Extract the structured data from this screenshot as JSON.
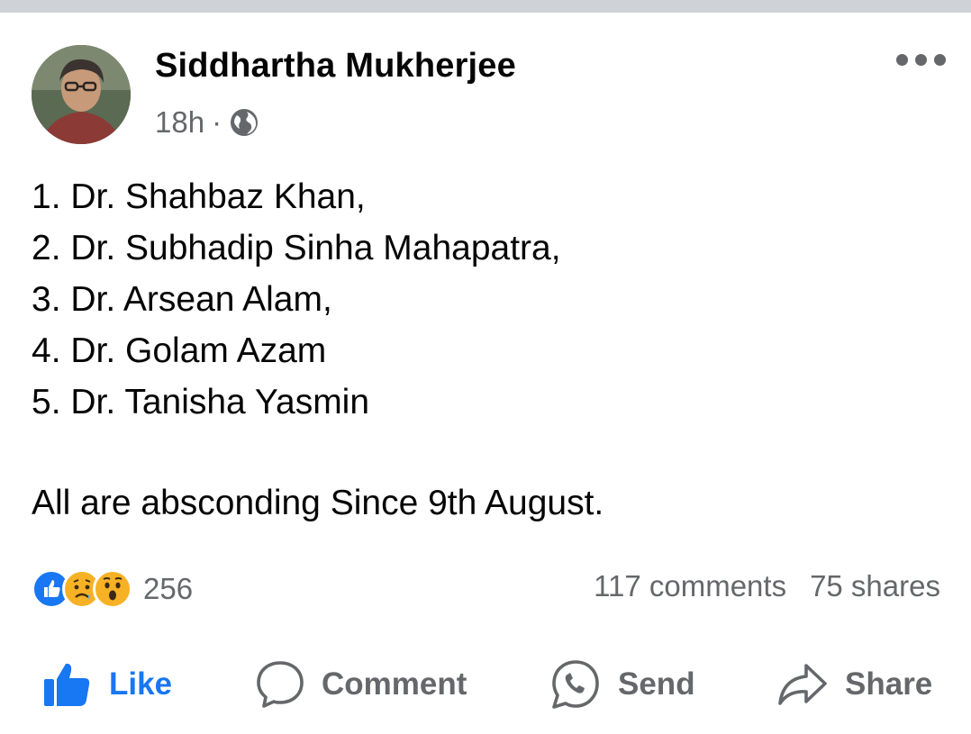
{
  "post": {
    "author": "Siddhartha Mukherjee",
    "time": "18h",
    "separator": "·",
    "privacy_icon": "globe-icon",
    "more_icon": "more-dots-icon",
    "lines": [
      "1. Dr. Shahbaz Khan,",
      "2. Dr. Subhadip Sinha Mahapatra,",
      "3. Dr. Arsean Alam,",
      "4. Dr. Golam Azam",
      "5. Dr. Tanisha Yasmin"
    ],
    "footer": "All are absconding Since 9th August."
  },
  "engagement": {
    "reaction_icons": [
      "like-reaction-icon",
      "sad-reaction-icon",
      "wow-reaction-icon"
    ],
    "reaction_count": "256",
    "comments": "117 comments",
    "shares": "75 shares"
  },
  "actions": {
    "like": "Like",
    "comment": "Comment",
    "send": "Send",
    "share": "Share"
  },
  "colors": {
    "accent": "#1877f2",
    "secondary_text": "#65676b",
    "primary_text": "#050505"
  }
}
